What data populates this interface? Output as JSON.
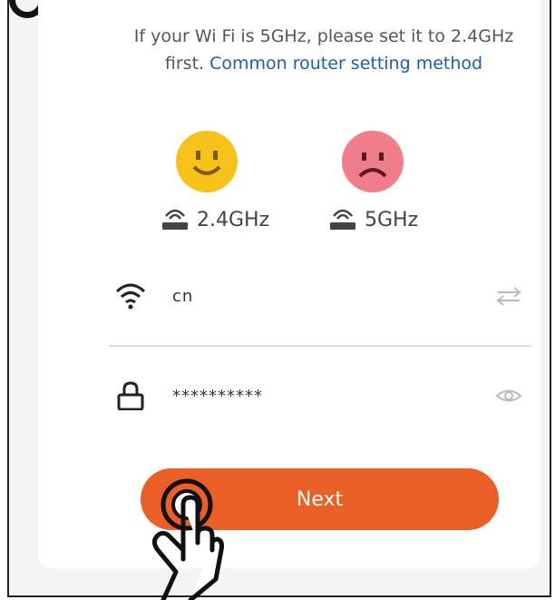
{
  "hint": {
    "text": "If your Wi Fi is 5GHz, please set it to 2.4GHz first. ",
    "link": "Common router setting method"
  },
  "bands": {
    "good": {
      "label": "2.4GHz",
      "face": "smile",
      "color": "#f6c21a"
    },
    "bad": {
      "label": "5GHz",
      "face": "frown",
      "color": "#f07d8a"
    }
  },
  "form": {
    "ssid_value": "cn",
    "password_value": "**********"
  },
  "buttons": {
    "next_label": "Next"
  },
  "colors": {
    "accent": "#ea5f25",
    "link": "#1a5fae"
  },
  "icons": [
    "wifi-icon",
    "swap-icon",
    "lock-icon",
    "eye-icon",
    "router-icon",
    "tap-hand-icon"
  ]
}
